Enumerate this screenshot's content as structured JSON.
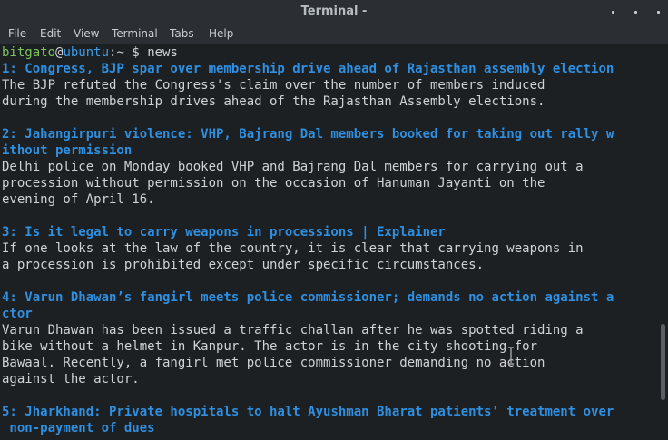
{
  "window": {
    "title": "Terminal -"
  },
  "menu": [
    "File",
    "Edit",
    "View",
    "Terminal",
    "Tabs",
    "Help"
  ],
  "prompt": {
    "user": "bitgato",
    "at": "@",
    "host": "ubuntu",
    "path": ":~ $ ",
    "command": "news"
  },
  "news": [
    {
      "head": [
        "1: Congress, BJP spar over membership drive ahead of Rajasthan assembly election"
      ],
      "body": [
        "The BJP refuted the Congress's claim over the number of members induced",
        "during the membership drives ahead of the Rajasthan Assembly elections."
      ]
    },
    {
      "head": [
        "2: Jahangirpuri violence: VHP, Bajrang Dal members booked for taking out rally w",
        "ithout permission"
      ],
      "body": [
        "Delhi police on Monday booked VHP and Bajrang Dal members for carrying out a",
        "procession without permission on the occasion of Hanuman Jayanti on the",
        "evening of April 16."
      ]
    },
    {
      "head": [
        "3: Is it legal to carry weapons in processions | Explainer"
      ],
      "body": [
        "If one looks at the law of the country, it is clear that carrying weapons in",
        "a procession is prohibited except under specific circumstances."
      ]
    },
    {
      "head": [
        "4: Varun Dhawan’s fangirl meets police commissioner; demands no action against a",
        "ctor"
      ],
      "body": [
        "Varun Dhawan has been issued a traffic challan after he was spotted riding a",
        "bike without a helmet in Kanpur. The actor is in the city shooting for",
        "Bawaal. Recently, a fangirl met police commissioner demanding no action",
        "against the actor."
      ]
    },
    {
      "head": [
        "5: Jharkhand: Private hospitals to halt Ayushman Bharat patients' treatment over",
        " non-payment of dues"
      ],
      "body": []
    }
  ]
}
